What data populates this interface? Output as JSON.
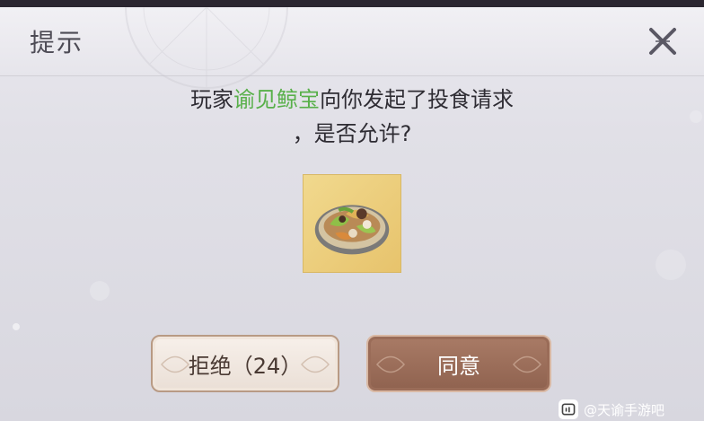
{
  "dialog": {
    "title": "提示",
    "message_line1_prefix": "玩家",
    "message_player_name": "谕见鲸宝",
    "message_line1_suffix": "向你发起了投食请求",
    "message_line2": "，是否允许?",
    "highlight_color": "#58b04a",
    "reject_label": "拒绝（24）",
    "accept_label": "同意",
    "food_icon": "stir-fry-dish-icon",
    "close_icon": "close-x-icon"
  },
  "watermark": {
    "text": "@天谕手游吧"
  }
}
